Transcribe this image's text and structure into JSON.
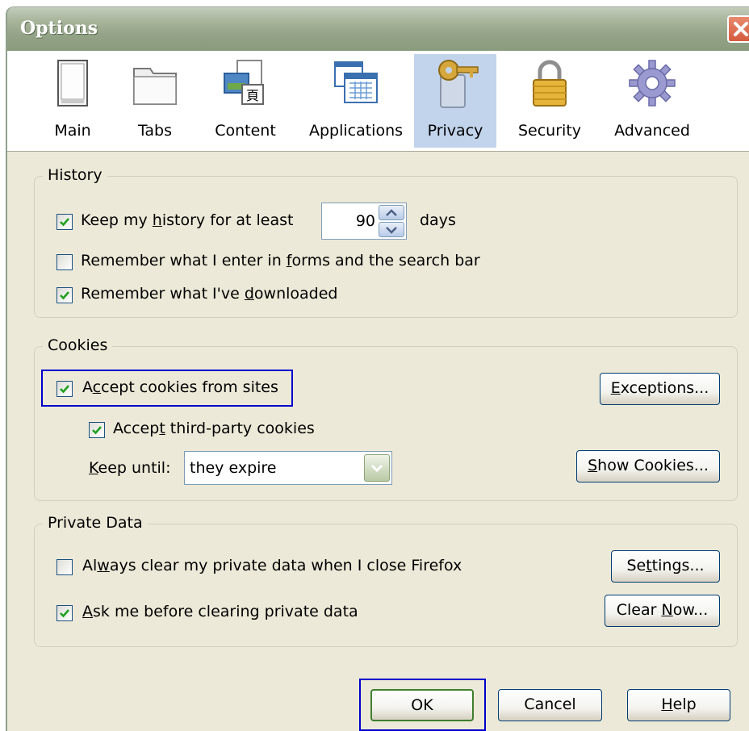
{
  "window": {
    "title": "Options"
  },
  "toolbar": {
    "tabs": [
      {
        "label": "Main",
        "icon": "window-icon"
      },
      {
        "label": "Tabs",
        "icon": "tabs-icon"
      },
      {
        "label": "Content",
        "icon": "content-icon"
      },
      {
        "label": "Applications",
        "icon": "applications-icon"
      },
      {
        "label": "Privacy",
        "icon": "privacy-key-icon",
        "selected": true
      },
      {
        "label": "Security",
        "icon": "padlock-icon"
      },
      {
        "label": "Advanced",
        "icon": "gear-icon"
      }
    ]
  },
  "history": {
    "legend": "History",
    "keep_history": {
      "checked": true,
      "pre": "Keep my ",
      "accel": "h",
      "post": "istory for at least"
    },
    "days_value": "90",
    "days_label": "days",
    "remember_forms": {
      "checked": false,
      "pre": "Remember what I enter in ",
      "accel": "f",
      "post": "orms and the search bar"
    },
    "remember_downloads": {
      "checked": true,
      "pre": "Remember what I've ",
      "accel": "d",
      "post": "ownloaded"
    }
  },
  "cookies": {
    "legend": "Cookies",
    "accept_cookies": {
      "checked": true,
      "pre": "A",
      "accel": "c",
      "post": "cept cookies from sites"
    },
    "accept_third_party": {
      "checked": true,
      "pre": "Accep",
      "accel": "t",
      "post": " third-party cookies"
    },
    "keep_until": {
      "pre": "",
      "accel": "K",
      "post": "eep until:"
    },
    "keep_until_value": "they expire",
    "exceptions_button": {
      "pre": "",
      "accel": "E",
      "post": "xceptions..."
    },
    "show_cookies_button": {
      "pre": "",
      "accel": "S",
      "post": "how Cookies..."
    }
  },
  "private_data": {
    "legend": "Private Data",
    "always_clear": {
      "checked": false,
      "pre": "Al",
      "accel": "w",
      "post": "ays clear my private data when I close Firefox"
    },
    "ask_before": {
      "checked": true,
      "pre": "",
      "accel": "A",
      "post": "sk me before clearing private data"
    },
    "settings_button": {
      "pre": "Se",
      "accel": "t",
      "post": "tings..."
    },
    "clear_now_button": {
      "pre": "Clear ",
      "accel": "N",
      "post": "ow..."
    }
  },
  "footer": {
    "ok_label": "OK",
    "cancel_label": "Cancel",
    "help_button": {
      "pre": "",
      "accel": "H",
      "post": "elp"
    }
  },
  "colors": {
    "dialog_bg": "#ece9d8",
    "titlebar": "#93a386",
    "selected_tab": "#c2d4ec",
    "check_green": "#21a121",
    "focus_blue": "#0000cc"
  }
}
